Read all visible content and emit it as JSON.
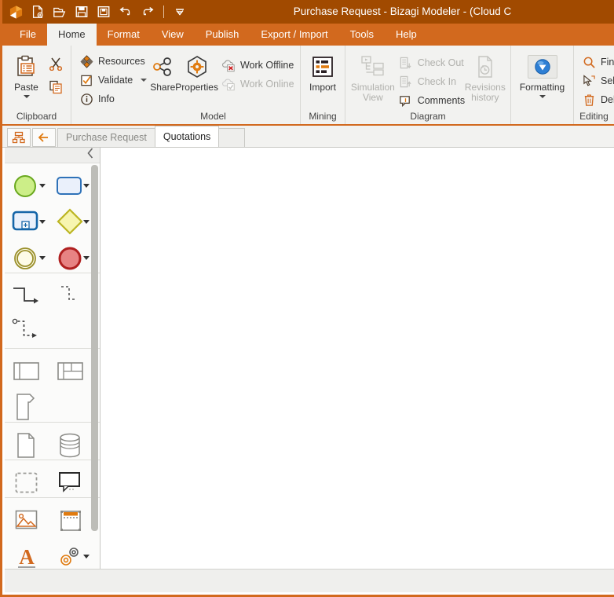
{
  "window": {
    "title": "Purchase Request - Bizagi Modeler - (Cloud C",
    "app_icon": "bizagi-logo-icon",
    "titlebar_color": "#a14a00",
    "accent_color": "#d2691e"
  },
  "quick_access": {
    "items": [
      {
        "name": "new-icon",
        "label": "New"
      },
      {
        "name": "open-icon",
        "label": "Open"
      },
      {
        "name": "save-icon",
        "label": "Save"
      },
      {
        "name": "save-as-icon",
        "label": "Save As"
      },
      {
        "name": "undo-icon",
        "label": "Undo"
      },
      {
        "name": "redo-icon",
        "label": "Redo"
      }
    ],
    "customize": {
      "name": "customize-qat-icon",
      "label": "Customize Quick Access Toolbar"
    }
  },
  "menu": {
    "items": [
      {
        "label": "File",
        "active": false
      },
      {
        "label": "Home",
        "active": true
      },
      {
        "label": "Format",
        "active": false
      },
      {
        "label": "View",
        "active": false
      },
      {
        "label": "Publish",
        "active": false
      },
      {
        "label": "Export / Import",
        "active": false
      },
      {
        "label": "Tools",
        "active": false
      },
      {
        "label": "Help",
        "active": false
      }
    ]
  },
  "ribbon": {
    "groups": [
      {
        "name": "clipboard",
        "label": "Clipboard",
        "big": {
          "label": "Paste",
          "icon": "paste-icon",
          "has_dropdown": true
        },
        "small": [
          {
            "label": "",
            "icon": "cut-icon",
            "disabled": false
          },
          {
            "label": "",
            "icon": "copy-icon",
            "disabled": false
          }
        ]
      },
      {
        "name": "model",
        "label": "Model",
        "items": [
          {
            "label": "Resources",
            "icon": "resources-icon",
            "disabled": false,
            "dropdown": false
          },
          {
            "label": "Validate",
            "icon": "validate-icon",
            "disabled": false,
            "dropdown": true
          },
          {
            "label": "Info",
            "icon": "info-icon",
            "disabled": false,
            "dropdown": false
          },
          {
            "label": "Share",
            "icon": "share-icon",
            "disabled": false,
            "dropdown": false
          },
          {
            "label": "Properties",
            "icon": "properties-gear-icon",
            "disabled": false,
            "dropdown": false
          },
          {
            "label": "Work Offline",
            "icon": "work-offline-icon",
            "disabled": false,
            "dropdown": false
          },
          {
            "label": "Work Online",
            "icon": "work-online-icon",
            "disabled": true,
            "dropdown": false
          }
        ]
      },
      {
        "name": "mining",
        "label": "Mining",
        "big": {
          "label": "Import",
          "icon": "import-icon",
          "has_dropdown": false
        }
      },
      {
        "name": "diagram",
        "label": "Diagram",
        "big_left": {
          "label": "Simulation View",
          "icon": "simulation-view-icon",
          "disabled": true
        },
        "big_right": {
          "label": "Revisions history",
          "icon": "revisions-history-icon",
          "disabled": true
        },
        "items": [
          {
            "label": "Check Out",
            "icon": "check-out-icon",
            "disabled": true
          },
          {
            "label": "Check In",
            "icon": "check-in-icon",
            "disabled": true
          },
          {
            "label": "Comments",
            "icon": "comments-icon",
            "disabled": false
          }
        ]
      },
      {
        "name": "formatting",
        "label": "",
        "big": {
          "label": "Formatting",
          "icon": "formatting-icon",
          "has_dropdown": true
        }
      },
      {
        "name": "editing",
        "label": "Editing",
        "items": [
          {
            "label": "Find",
            "icon": "search-icon",
            "disabled": false
          },
          {
            "label": "Select",
            "icon": "select-cursor-icon",
            "disabled": false
          },
          {
            "label": "Delete",
            "icon": "delete-trash-icon",
            "disabled": false
          }
        ]
      }
    ]
  },
  "diagram_tabs": {
    "model_view_button": {
      "name": "model-view-icon",
      "label": "Model view"
    },
    "back_button": {
      "name": "back-arrow-icon",
      "label": "Back"
    },
    "tabs": [
      {
        "label": "Purchase Request",
        "active": false
      },
      {
        "label": "Quotations",
        "active": true
      }
    ]
  },
  "palette": {
    "collapse_button": {
      "name": "collapse-palette-icon",
      "label": "Collapse palette"
    },
    "sections": [
      {
        "name": "events-activities",
        "cells": [
          {
            "name": "start-event-shape",
            "icon": "start-event",
            "dropdown": true
          },
          {
            "name": "task-shape",
            "icon": "task",
            "dropdown": true
          },
          {
            "name": "subprocess-shape",
            "icon": "subprocess",
            "dropdown": true
          },
          {
            "name": "gateway-shape",
            "icon": "gateway",
            "dropdown": true
          },
          {
            "name": "intermediate-event-shape",
            "icon": "intermediate-event",
            "dropdown": true
          },
          {
            "name": "end-event-shape",
            "icon": "end-event",
            "dropdown": true
          }
        ]
      },
      {
        "name": "connectors",
        "cells": [
          {
            "name": "sequence-flow-connector",
            "icon": "sequence-flow",
            "dropdown": false
          },
          {
            "name": "message-flow-connector",
            "icon": "message-flow",
            "dropdown": false
          },
          {
            "name": "association-connector",
            "icon": "association",
            "dropdown": false
          }
        ]
      },
      {
        "name": "pools-lanes",
        "cells": [
          {
            "name": "pool-shape",
            "icon": "pool",
            "dropdown": false
          },
          {
            "name": "lane-shape",
            "icon": "lane",
            "dropdown": false
          },
          {
            "name": "milestone-shape",
            "icon": "milestone",
            "dropdown": false
          }
        ]
      },
      {
        "name": "data",
        "cells": [
          {
            "name": "data-object-shape",
            "icon": "data-object",
            "dropdown": false
          },
          {
            "name": "data-store-shape",
            "icon": "data-store",
            "dropdown": false
          }
        ]
      },
      {
        "name": "artifacts-group",
        "cells": [
          {
            "name": "group-shape",
            "icon": "group",
            "dropdown": false
          },
          {
            "name": "annotation-shape",
            "icon": "annotation",
            "dropdown": false
          }
        ]
      },
      {
        "name": "extras",
        "cells": [
          {
            "name": "image-shape",
            "icon": "image",
            "dropdown": false
          },
          {
            "name": "header-shape",
            "icon": "header",
            "dropdown": false
          },
          {
            "name": "text-shape",
            "icon": "text",
            "dropdown": false
          },
          {
            "name": "custom-shapes",
            "icon": "custom-shapes",
            "dropdown": true
          }
        ]
      }
    ]
  },
  "canvas": {
    "name": "diagram-canvas",
    "content": ""
  }
}
